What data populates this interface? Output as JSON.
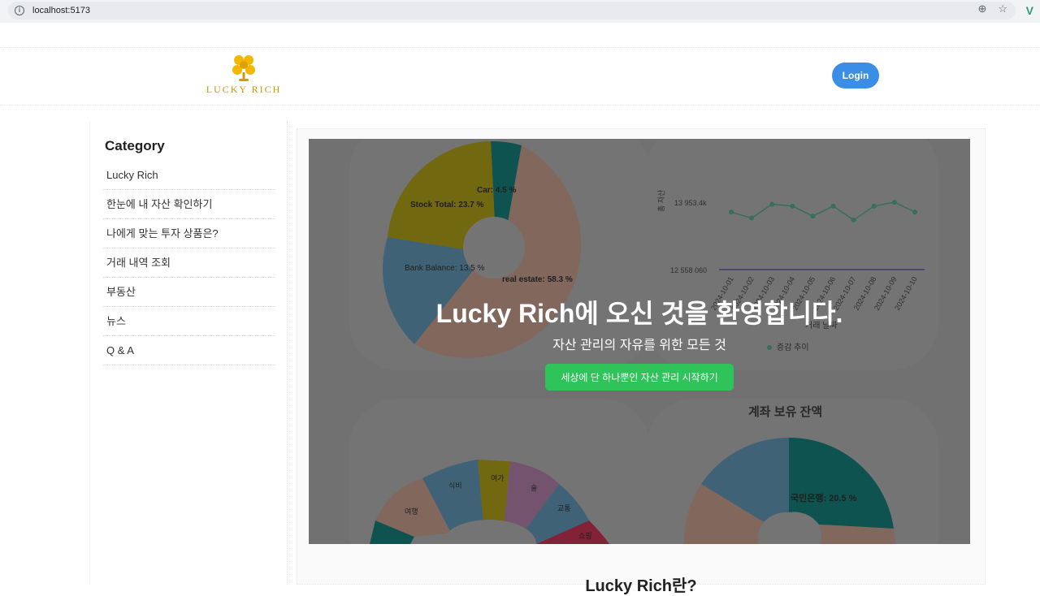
{
  "browser": {
    "url": "localhost:5173"
  },
  "header": {
    "brand_text": "LUCKY  RICH",
    "login_label": "Login"
  },
  "sidebar": {
    "title": "Category",
    "items": [
      {
        "label": "Lucky Rich"
      },
      {
        "label": "한눈에 내 자산 확인하기"
      },
      {
        "label": "나에게 맞는 투자 상품은?"
      },
      {
        "label": "거래 내역 조회"
      },
      {
        "label": "부동산"
      },
      {
        "label": "뉴스"
      },
      {
        "label": "Q & A"
      }
    ]
  },
  "hero": {
    "title": "Lucky Rich에 오신 것을 환영합니다.",
    "subtitle": "자산 관리의 자유를 위한 모든 것",
    "cta_label": "세상에 단 하나뿐인 자산 관리 시작하기"
  },
  "about": {
    "title": "Lucky Rich란?"
  },
  "colors": {
    "accent": "#3a8ee6",
    "cta": "#2ec45a",
    "brand": "#c99a00"
  },
  "background_charts": {
    "asset_pie": {
      "slices": [
        {
          "label": "Car: 4.5 %",
          "value": 4.5
        },
        {
          "label": "real estate: 58.3 %",
          "value": 58.3
        },
        {
          "label": "Bank Balance: 13.5 %",
          "value": 13.5
        },
        {
          "label": "Stock Total: 23.7 %",
          "value": 23.7
        }
      ]
    },
    "trend_line": {
      "y_axis_label": "총 자산",
      "y_ticks": [
        "13 953.4k",
        "12 558 060"
      ],
      "x_categories": [
        "2024-10-01",
        "2024-10-02",
        "2024-10-03",
        "2024-10-04",
        "2024-10-05",
        "2024-10-06",
        "2024-10-07",
        "2024-10-08",
        "2024-10-09",
        "2024-10-10"
      ],
      "x_axis_label": "거래 날짜",
      "legend": "증감 추이",
      "values": [
        13.93,
        13.9,
        13.97,
        13.96,
        13.91,
        13.96,
        13.89,
        13.96,
        13.98,
        13.93
      ]
    },
    "spending_pie": {
      "labels": [
        "여행",
        "식비",
        "여가",
        "술",
        "교통",
        "쇼핑"
      ]
    },
    "account_pie": {
      "title": "계좌 보유 잔액",
      "label": "국민은행: 20.5 %"
    }
  }
}
